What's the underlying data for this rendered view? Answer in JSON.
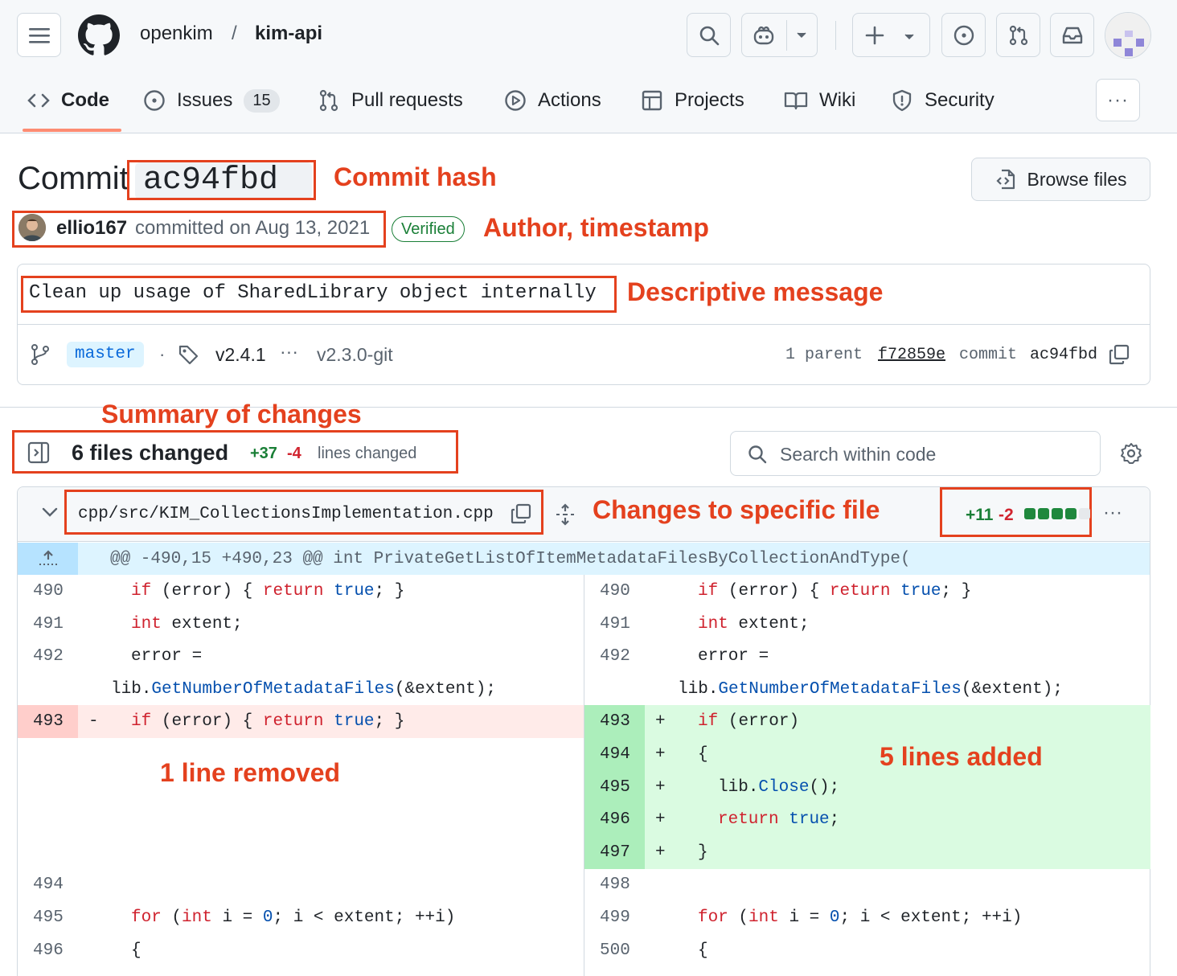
{
  "header": {
    "owner": "openkim",
    "separator": "/",
    "repo": "kim-api"
  },
  "nav": {
    "tabs": [
      {
        "label": "Code",
        "icon": "code-icon"
      },
      {
        "label": "Issues",
        "icon": "issue-icon",
        "count": "15"
      },
      {
        "label": "Pull requests",
        "icon": "pull-request-icon"
      },
      {
        "label": "Actions",
        "icon": "play-icon"
      },
      {
        "label": "Projects",
        "icon": "table-icon"
      },
      {
        "label": "Wiki",
        "icon": "book-icon"
      },
      {
        "label": "Security",
        "icon": "shield-icon"
      }
    ],
    "more": "···"
  },
  "commit": {
    "title_prefix": "Commit",
    "hash": "ac94fbd",
    "browse_files": "Browse files",
    "author": "ellio167",
    "committed_text": "committed on Aug 13, 2021",
    "verified": "Verified",
    "message": "Clean up usage of SharedLibrary object internally",
    "branch": "master",
    "tag_latest": "v2.4.1",
    "tag_ellipsis": "···",
    "tag_oldest": "v2.3.0-git",
    "parent_label": "1 parent",
    "parent_hash": "f72859e",
    "commit_label": "commit",
    "commit_hash": "ac94fbd"
  },
  "annotations": {
    "commit_hash": "Commit hash",
    "author": "Author, timestamp",
    "message": "Descriptive message",
    "summary": "Summary of changes",
    "file": "Changes to specific file",
    "removed": "1 line removed",
    "added": "5 lines added"
  },
  "summary": {
    "files_changed": "6 files changed",
    "additions": "+37",
    "deletions": "-4",
    "lines_changed": "lines changed",
    "search_placeholder": "Search within code"
  },
  "file": {
    "path": "cpp/src/KIM_CollectionsImplementation.cpp",
    "additions": "+11",
    "deletions": "-2",
    "hunk": "@@ -490,15 +490,23 @@ int PrivateGetListOfItemMetadataFilesByCollectionAndType(",
    "menu": "···"
  },
  "diff": {
    "left": [
      {
        "n": "490",
        "sign": "",
        "type": "ctx",
        "code": "if (error) { return true; }",
        "indent": 1
      },
      {
        "n": "491",
        "sign": "",
        "type": "ctx",
        "code": "int extent;",
        "indent": 1
      },
      {
        "n": "492",
        "sign": "",
        "type": "ctx",
        "code": "error =",
        "indent": 1
      },
      {
        "n": "",
        "sign": "",
        "type": "ctx",
        "code": "lib.GetNumberOfMetadataFiles(&extent);",
        "indent": 0
      },
      {
        "n": "493",
        "sign": "-",
        "type": "del",
        "code": "if (error) { return true; }",
        "indent": 1
      },
      {
        "n": "494",
        "sign": "",
        "type": "ctx",
        "code": "",
        "indent": 1
      },
      {
        "n": "495",
        "sign": "",
        "type": "ctx",
        "code": "for (int i = 0; i < extent; ++i)",
        "indent": 1
      },
      {
        "n": "496",
        "sign": "",
        "type": "ctx",
        "code": "{",
        "indent": 1
      }
    ],
    "right": [
      {
        "n": "490",
        "sign": "",
        "type": "ctx",
        "code": "if (error) { return true; }",
        "indent": 1
      },
      {
        "n": "491",
        "sign": "",
        "type": "ctx",
        "code": "int extent;",
        "indent": 1
      },
      {
        "n": "492",
        "sign": "",
        "type": "ctx",
        "code": "error =",
        "indent": 1
      },
      {
        "n": "",
        "sign": "",
        "type": "ctx",
        "code": "lib.GetNumberOfMetadataFiles(&extent);",
        "indent": 0
      },
      {
        "n": "493",
        "sign": "+",
        "type": "add",
        "code": "if (error)",
        "indent": 1
      },
      {
        "n": "494",
        "sign": "+",
        "type": "add",
        "code": "{",
        "indent": 1
      },
      {
        "n": "495",
        "sign": "+",
        "type": "add",
        "code": "lib.Close();",
        "indent": 2
      },
      {
        "n": "496",
        "sign": "+",
        "type": "add",
        "code": "return true;",
        "indent": 2
      },
      {
        "n": "497",
        "sign": "+",
        "type": "add",
        "code": "}",
        "indent": 1
      },
      {
        "n": "498",
        "sign": "",
        "type": "ctx",
        "code": "",
        "indent": 1
      },
      {
        "n": "499",
        "sign": "",
        "type": "ctx",
        "code": "for (int i = 0; i < extent; ++i)",
        "indent": 1
      },
      {
        "n": "500",
        "sign": "",
        "type": "ctx",
        "code": "{",
        "indent": 1
      }
    ]
  },
  "colors": {
    "annotation": "#e4411e",
    "add_bg": "#dafbe1",
    "add_num_bg": "#aceebb",
    "del_bg": "#ffebe9",
    "del_num_bg": "#ffcecb",
    "hunk_bg": "#ddf4ff",
    "keyword": "#cf222e",
    "literal": "#0550ae"
  }
}
